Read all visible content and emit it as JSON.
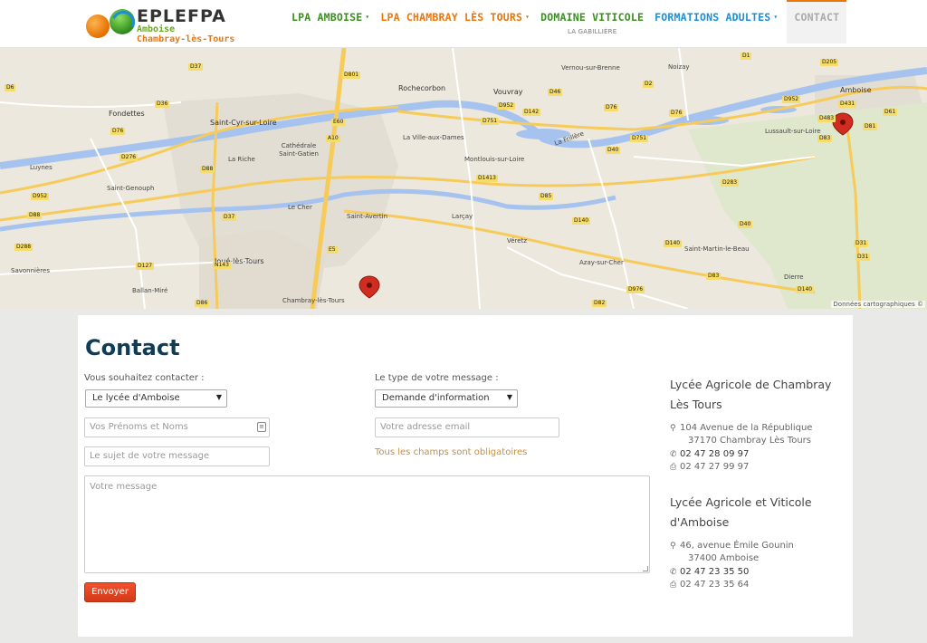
{
  "brand": {
    "name": "EPLEFPA",
    "sub1": "Amboise",
    "sub2": "Chambray-lès-Tours"
  },
  "nav": {
    "items": [
      {
        "label": "LPA AMBOISE",
        "color": "#3a8f20",
        "caret": "▾"
      },
      {
        "label": "LPA CHAMBRAY LÈS TOURS",
        "color": "#e8760a",
        "caret": "▾"
      },
      {
        "label": "DOMAINE VITICOLE",
        "color": "#3a8f20",
        "sub": "LA GABILLIÈRE"
      },
      {
        "label": "FORMATIONS ADULTES",
        "color": "#1a8fd6",
        "caret": "▾"
      },
      {
        "label": "CONTACT",
        "color": "#aaaaaa",
        "active": true
      }
    ]
  },
  "map": {
    "cities": [
      "Fondettes",
      "Saint-Cyr-sur-Loire",
      "Rochecorbon",
      "Vouvray",
      "Vernou-sur-Brenne",
      "Noizay",
      "Amboise",
      "Luynes",
      "La Riche",
      "Cathédrale Saint-Gatien",
      "La Ville-aux-Dames",
      "Montlouis-sur-Loire",
      "Lussault-sur-Loire",
      "Saint-Genouph",
      "Saint-Avertin",
      "Larçay",
      "Joué-lès-Tours",
      "Véretz",
      "Azay-sur-Cher",
      "Saint-Martin-le-Beau",
      "Ballan-Miré",
      "Chambray-lès-Tours",
      "Savonnières",
      "Dierre",
      "La Frillère",
      "Le Cher"
    ],
    "roads": [
      "D37",
      "D801",
      "D46",
      "D1",
      "D205",
      "D6",
      "D2",
      "D76",
      "D952",
      "D142",
      "D76",
      "D36",
      "D751",
      "D431",
      "D483",
      "D81",
      "D61",
      "D76",
      "D88",
      "D276",
      "D952",
      "D40",
      "D751",
      "D31",
      "D83",
      "D952",
      "D88",
      "D37",
      "D1413",
      "D85",
      "D283",
      "D140",
      "D288",
      "D40",
      "D140",
      "D31",
      "D127",
      "D976",
      "D83",
      "D82",
      "D86",
      "D140",
      "E5",
      "A10",
      "E60",
      "N143"
    ],
    "credit": "Données cartographiques ©"
  },
  "contact": {
    "title": "Contact",
    "to_label": "Vous souhaitez contacter :",
    "to_value": "Le lycée d'Amboise",
    "type_label": "Le type de votre message :",
    "type_value": "Demande d'information",
    "name_placeholder": "Vos Prénoms et Noms",
    "email_placeholder": "Votre adresse email",
    "subject_placeholder": "Le sujet de votre message",
    "required_note": "Tous les champs sont obligatoires",
    "message_placeholder": "Votre message",
    "send_label": "Envoyer"
  },
  "sites": [
    {
      "title": "Lycée Agricole de Chambray Lès Tours",
      "address1": "104 Avenue de la République",
      "address2": "37170 Chambray Lès Tours",
      "phone": "02 47 28 09 97",
      "fax": "02 47 27 99 97"
    },
    {
      "title": "Lycée Agricole et Viticole d'Amboise",
      "address1": "46, avenue Émile Gounin",
      "address2": "37400 Amboise",
      "phone": "02 47 23 35 50",
      "fax": "02 47 23 35 64"
    }
  ],
  "colors": {
    "title": "#0f3d57",
    "accent_orange": "#e8760a",
    "send_button": "#e0441f",
    "river": "#a5c3ee",
    "road_major": "#f6cb5a"
  }
}
